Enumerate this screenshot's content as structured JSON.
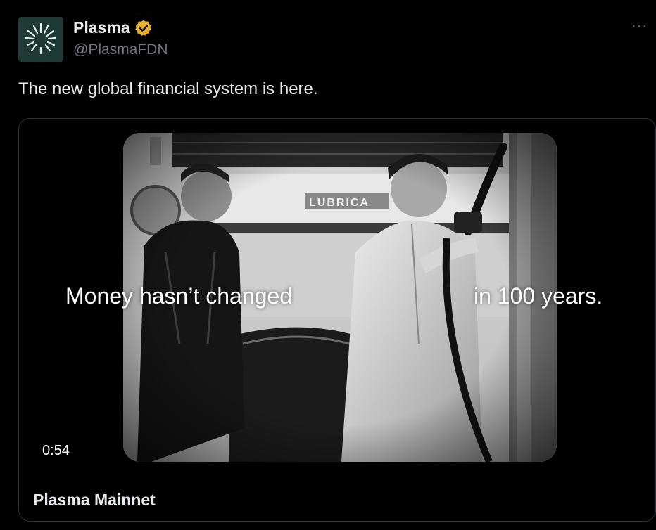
{
  "author": {
    "name": "Plasma",
    "handle": "@PlasmaFDN",
    "verified": true,
    "avatar_icon": "plasma-logo-icon",
    "badge_icon": "verified-badge-icon",
    "badge_color": "#e8b12d"
  },
  "menu": {
    "more_label": "···"
  },
  "tweet": {
    "text": "The new global financial system is here."
  },
  "card": {
    "caption_left": "Money hasn’t changed",
    "caption_right": "in 100 years.",
    "sign_text": "LUBRICA",
    "duration": "0:54",
    "title": "Plasma Mainnet"
  },
  "colors": {
    "background": "#000000",
    "text": "#e7e9ea",
    "muted": "#71767b",
    "border": "#2f3336"
  }
}
